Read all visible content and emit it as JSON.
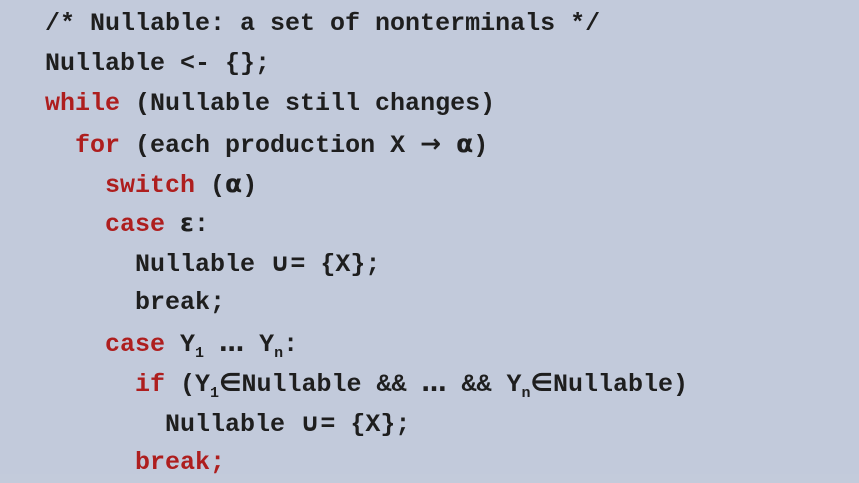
{
  "lines": [
    {
      "parts": [
        {
          "t": "/* Nullable: a set of nonterminals */"
        }
      ]
    },
    {
      "parts": [
        {
          "t": "Nullable <- {};"
        }
      ]
    },
    {
      "parts": [
        {
          "t": "while",
          "kw": true
        },
        {
          "t": " (Nullable still changes)"
        }
      ]
    },
    {
      "parts": [
        {
          "t": "  "
        },
        {
          "t": "for",
          "kw": true
        },
        {
          "t": " (each production X "
        },
        {
          "t": "→",
          "sym": true
        },
        {
          "t": " "
        },
        {
          "t": "α",
          "sym": true
        },
        {
          "t": ")"
        }
      ]
    },
    {
      "parts": [
        {
          "t": "    "
        },
        {
          "t": "switch",
          "kw": true
        },
        {
          "t": " ("
        },
        {
          "t": "α",
          "sym": true
        },
        {
          "t": ")"
        }
      ]
    },
    {
      "parts": [
        {
          "t": "    "
        },
        {
          "t": "case",
          "kw": true
        },
        {
          "t": " "
        },
        {
          "t": "ε",
          "sym": true
        },
        {
          "t": ":"
        }
      ]
    },
    {
      "parts": [
        {
          "t": "      Nullable "
        },
        {
          "t": "∪",
          "sym": true
        },
        {
          "t": "= {X};"
        }
      ]
    },
    {
      "parts": [
        {
          "t": "      break;"
        }
      ]
    },
    {
      "parts": [
        {
          "t": "    "
        },
        {
          "t": "case",
          "kw": true
        },
        {
          "t": " Y"
        },
        {
          "t": "1",
          "sub": true
        },
        {
          "t": " "
        },
        {
          "t": "…",
          "sym": true
        },
        {
          "t": " Y"
        },
        {
          "t": "n",
          "sub": true
        },
        {
          "t": ":"
        }
      ]
    },
    {
      "parts": [
        {
          "t": "      "
        },
        {
          "t": "if",
          "kw": true
        },
        {
          "t": " (Y"
        },
        {
          "t": "1",
          "sub": true
        },
        {
          "t": "∈",
          "sym": true
        },
        {
          "t": "Nullable && "
        },
        {
          "t": "…",
          "sym": true
        },
        {
          "t": " && Y"
        },
        {
          "t": "n",
          "sub": true
        },
        {
          "t": "∈",
          "sym": true
        },
        {
          "t": "Nullable)"
        }
      ]
    },
    {
      "parts": [
        {
          "t": "        Nullable "
        },
        {
          "t": "∪",
          "sym": true
        },
        {
          "t": "= {X};"
        }
      ]
    },
    {
      "parts": [
        {
          "t": "      "
        },
        {
          "t": "break;",
          "kw": true
        }
      ]
    }
  ]
}
